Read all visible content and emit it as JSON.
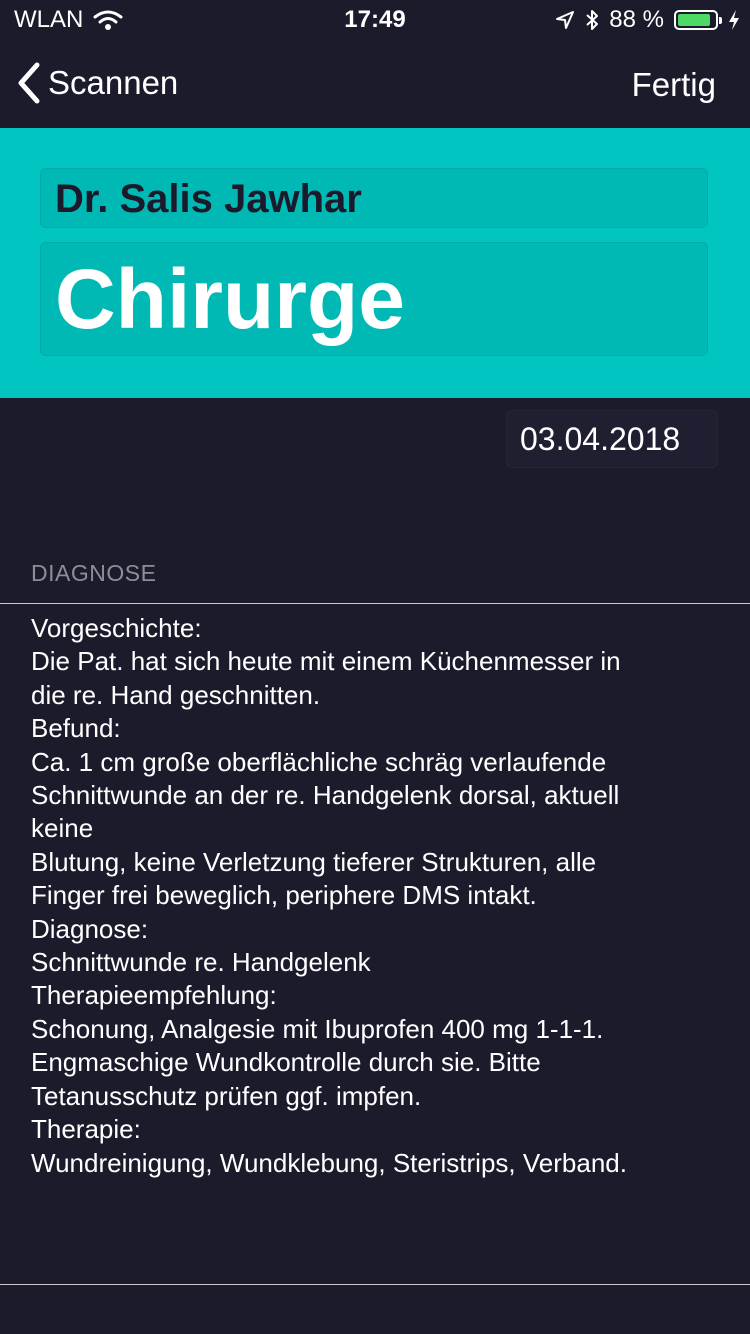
{
  "status_bar": {
    "carrier": "WLAN",
    "time": "17:49",
    "battery_percent": "88 %",
    "battery_level": 0.88,
    "battery_color": "#4cd964"
  },
  "nav": {
    "back_label": "Scannen",
    "done_label": "Fertig"
  },
  "card": {
    "background": "#00c5c1",
    "doctor_name": "Dr. Salis Jawhar",
    "role": "Chirurge"
  },
  "date": "03.04.2018",
  "section_title": "DIAGNOSE",
  "diagnosis_lines": [
    "Vorgeschichte:",
    "Die Pat. hat sich heute mit einem Küchenmesser in",
    "die re. Hand geschnitten.",
    "Befund:",
    "Ca. 1 cm große oberflächliche schräg verlaufende",
    "Schnittwunde an der re. Handgelenk dorsal, aktuell",
    "keine",
    "Blutung, keine Verletzung tieferer Strukturen, alle",
    "Finger frei beweglich, periphere DMS intakt.",
    "Diagnose:",
    "Schnittwunde re. Handgelenk",
    "Therapieempfehlung:",
    "Schonung, Analgesie mit Ibuprofen 400 mg 1-1-1.",
    "Engmaschige Wundkontrolle durch sie. Bitte",
    "Tetanusschutz prüfen ggf. impfen.",
    "Therapie:",
    "Wundreinigung, Wundklebung, Steristrips, Verband."
  ]
}
